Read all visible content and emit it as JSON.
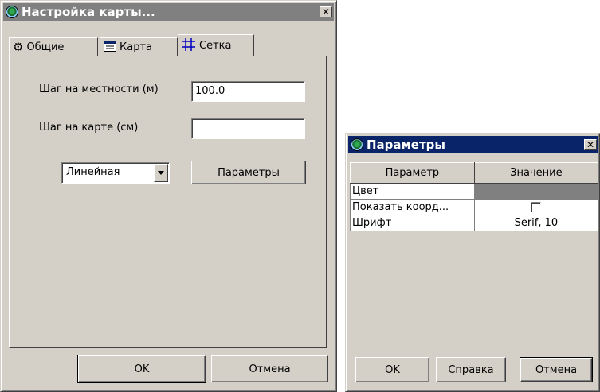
{
  "map_settings": {
    "title": "Настройка карты...",
    "tabs": [
      {
        "label": "Общие",
        "icon": "gears-icon"
      },
      {
        "label": "Карта",
        "icon": "map-window-icon"
      },
      {
        "label": "Сетка",
        "icon": "grid-icon",
        "active": true
      }
    ],
    "ground_step_label": "Шаг на местности (м)",
    "ground_step_value": "100.0",
    "map_step_label": "Шаг на карте (см)",
    "map_step_value": "",
    "grid_type_value": "Линейная",
    "params_button": "Параметры",
    "ok_button": "OK",
    "cancel_button": "Отмена"
  },
  "params_dialog": {
    "title": "Параметры",
    "columns": [
      "Параметр",
      "Значение"
    ],
    "rows": [
      {
        "name": "Цвет",
        "value": "",
        "kind": "color",
        "color": "#808080"
      },
      {
        "name": "Показать коорд...",
        "value": "",
        "kind": "checkbox",
        "checked": false
      },
      {
        "name": "Шрифт",
        "value": "Serif, 10",
        "kind": "text"
      }
    ],
    "ok_button": "OK",
    "help_button": "Справка",
    "cancel_button": "Отмена"
  },
  "colors": {
    "face": "#d4d0c8",
    "active_title": "#0a246a",
    "inactive_title": "#808080"
  }
}
